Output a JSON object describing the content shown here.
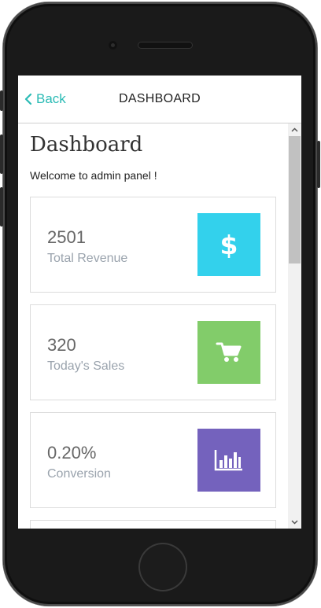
{
  "navbar": {
    "back_label": "Back",
    "title": "DASHBOARD"
  },
  "page": {
    "title": "Dashboard",
    "welcome": "Welcome to admin panel !"
  },
  "cards": [
    {
      "value": "2501",
      "label": "Total Revenue",
      "icon": "dollar-icon",
      "color": "#33d1ec"
    },
    {
      "value": "320",
      "label": "Today's Sales",
      "icon": "cart-icon",
      "color": "#82cc6a"
    },
    {
      "value": "0.20%",
      "label": "Conversion",
      "icon": "bar-chart-icon",
      "color": "#7462bd"
    }
  ],
  "colors": {
    "accent": "#2bbbb5"
  }
}
